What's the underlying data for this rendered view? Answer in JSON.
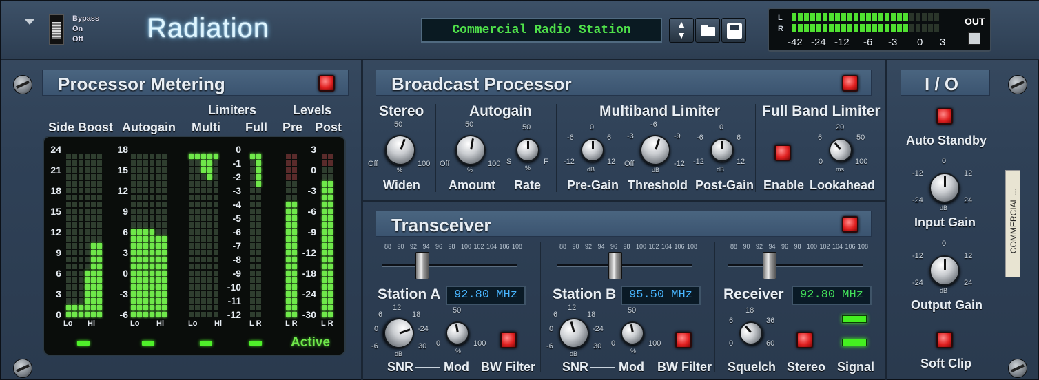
{
  "header": {
    "title": "Radiation",
    "bypass": "Bypass",
    "on": "On",
    "off": "Off",
    "preset": "Commercial Radio Station",
    "lr_l": "L",
    "lr_r": "R",
    "out": "OUT",
    "vu_scale": [
      "-42",
      "-24",
      "-12",
      "-6",
      "-3",
      "0",
      "3"
    ]
  },
  "metering": {
    "title": "Processor Metering",
    "side_boost": "Side Boost",
    "autogain": "Autogain",
    "limiters": "Limiters",
    "multi": "Multi",
    "full": "Full",
    "levels": "Levels",
    "pre": "Pre",
    "post": "Post",
    "scale_side": [
      "24",
      "21",
      "18",
      "15",
      "12",
      "9",
      "6",
      "3",
      "0"
    ],
    "scale_auto": [
      "18",
      "15",
      "12",
      "9",
      "6",
      "3",
      "0",
      "-3",
      "-6"
    ],
    "scale_lim": [
      "0",
      "-1",
      "-2",
      "-3",
      "-4",
      "-5",
      "-6",
      "-7",
      "-8",
      "-9",
      "-10",
      "-11",
      "-12"
    ],
    "scale_lev": [
      "3",
      "0",
      "-3",
      "-6",
      "-9",
      "-12",
      "-18",
      "-24",
      "-30"
    ],
    "lo": "Lo",
    "hi": "Hi",
    "lr": "L R",
    "active": "Active",
    "levels_fraction": {
      "side_lo": 0.1,
      "side_hi": 0.3,
      "side_hi2": 0.45,
      "auto_lo": 0.55,
      "auto_hi": 0.5,
      "pre": 0.72,
      "post": 0.85
    }
  },
  "broadcast": {
    "title": "Broadcast Processor",
    "stereo": "Stereo",
    "autogain": "Autogain",
    "multiband": "Multiband Limiter",
    "fullband": "Full Band Limiter",
    "widen": "Widen",
    "amount": "Amount",
    "rate": "Rate",
    "pregain": "Pre-Gain",
    "threshold": "Threshold",
    "postgain": "Post-Gain",
    "enable": "Enable",
    "lookahead": "Lookahead",
    "off": "Off",
    "p50": "50",
    "p100": "100",
    "pct": "%",
    "s": "S",
    "f": "F",
    "db": "dB",
    "m6": "-6",
    "p6": "6",
    "z": "0",
    "m12": "-12",
    "p12": "12",
    "m3": "-3",
    "m9": "-9",
    "ms": "ms",
    "n20": "20"
  },
  "transceiver": {
    "title": "Transceiver",
    "station_a": "Station A",
    "station_b": "Station B",
    "receiver": "Receiver",
    "freq_a": "92.80 MHz",
    "freq_b": "95.50 MHz",
    "freq_r": "92.80 MHz",
    "snr": "SNR",
    "mod": "Mod",
    "bw": "BW Filter",
    "squelch": "Squelch",
    "stereo": "Stereo",
    "signal": "Signal",
    "freq_scale": [
      "88",
      "90",
      "92",
      "94",
      "96",
      "98",
      "100",
      "102",
      "104",
      "106",
      "108"
    ],
    "snr_scale": {
      "a": "6",
      "b": "12",
      "c": "18",
      "d": "-24",
      "e": "30",
      "f": "0",
      "g": "-6"
    },
    "mod_scale": {
      "a": "50",
      "b": "0",
      "c": "100",
      "d": "%"
    },
    "sq_scale": {
      "a": "18",
      "b": "6",
      "c": "36",
      "d": "0",
      "e": "60"
    },
    "slider_fraction": {
      "a": 0.25,
      "b": 0.38,
      "r": 0.26
    }
  },
  "io": {
    "title": "I / O",
    "auto_standby": "Auto Standby",
    "input_gain": "Input Gain",
    "output_gain": "Output Gain",
    "soft_clip": "Soft Clip",
    "tape": "COMMERCIAL ...",
    "z": "0",
    "m12": "-12",
    "p12": "12",
    "m24": "-24",
    "p24": "24",
    "db": "dB"
  }
}
